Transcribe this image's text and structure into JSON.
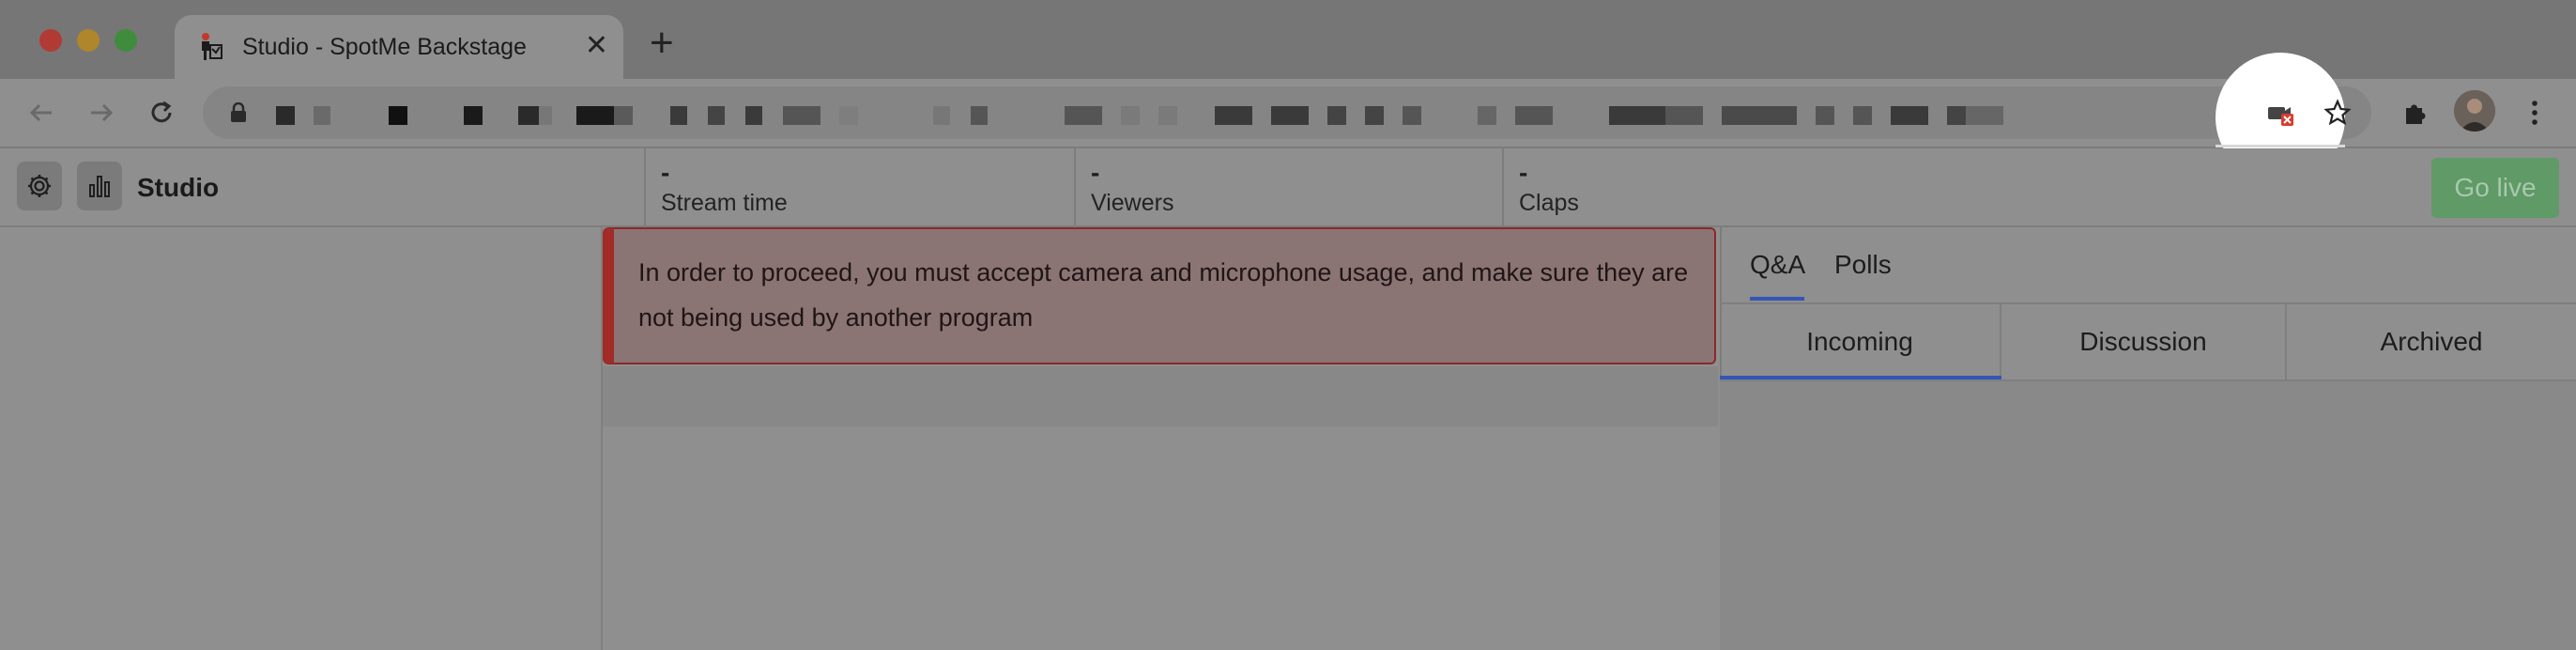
{
  "browser": {
    "tab_title": "Studio - SpotMe Backstage",
    "tab_close": "✕",
    "new_tab": "+"
  },
  "colors": {
    "accent": "#3457b5",
    "alert_border": "#a12b27",
    "go_live": "#5f9a67"
  },
  "app": {
    "title": "Studio",
    "stats": [
      {
        "value": "-",
        "label": "Stream time"
      },
      {
        "value": "-",
        "label": "Viewers"
      },
      {
        "value": "-",
        "label": "Claps"
      }
    ],
    "go_live": "Go live"
  },
  "alert": {
    "message": "In order to proceed, you must accept camera and microphone usage, and make sure they are not being used by another program"
  },
  "sidebar": {
    "tabs": [
      {
        "label": "Q&A"
      },
      {
        "label": "Polls"
      }
    ],
    "segments": [
      {
        "label": "Incoming"
      },
      {
        "label": "Discussion"
      },
      {
        "label": "Archived"
      }
    ]
  }
}
